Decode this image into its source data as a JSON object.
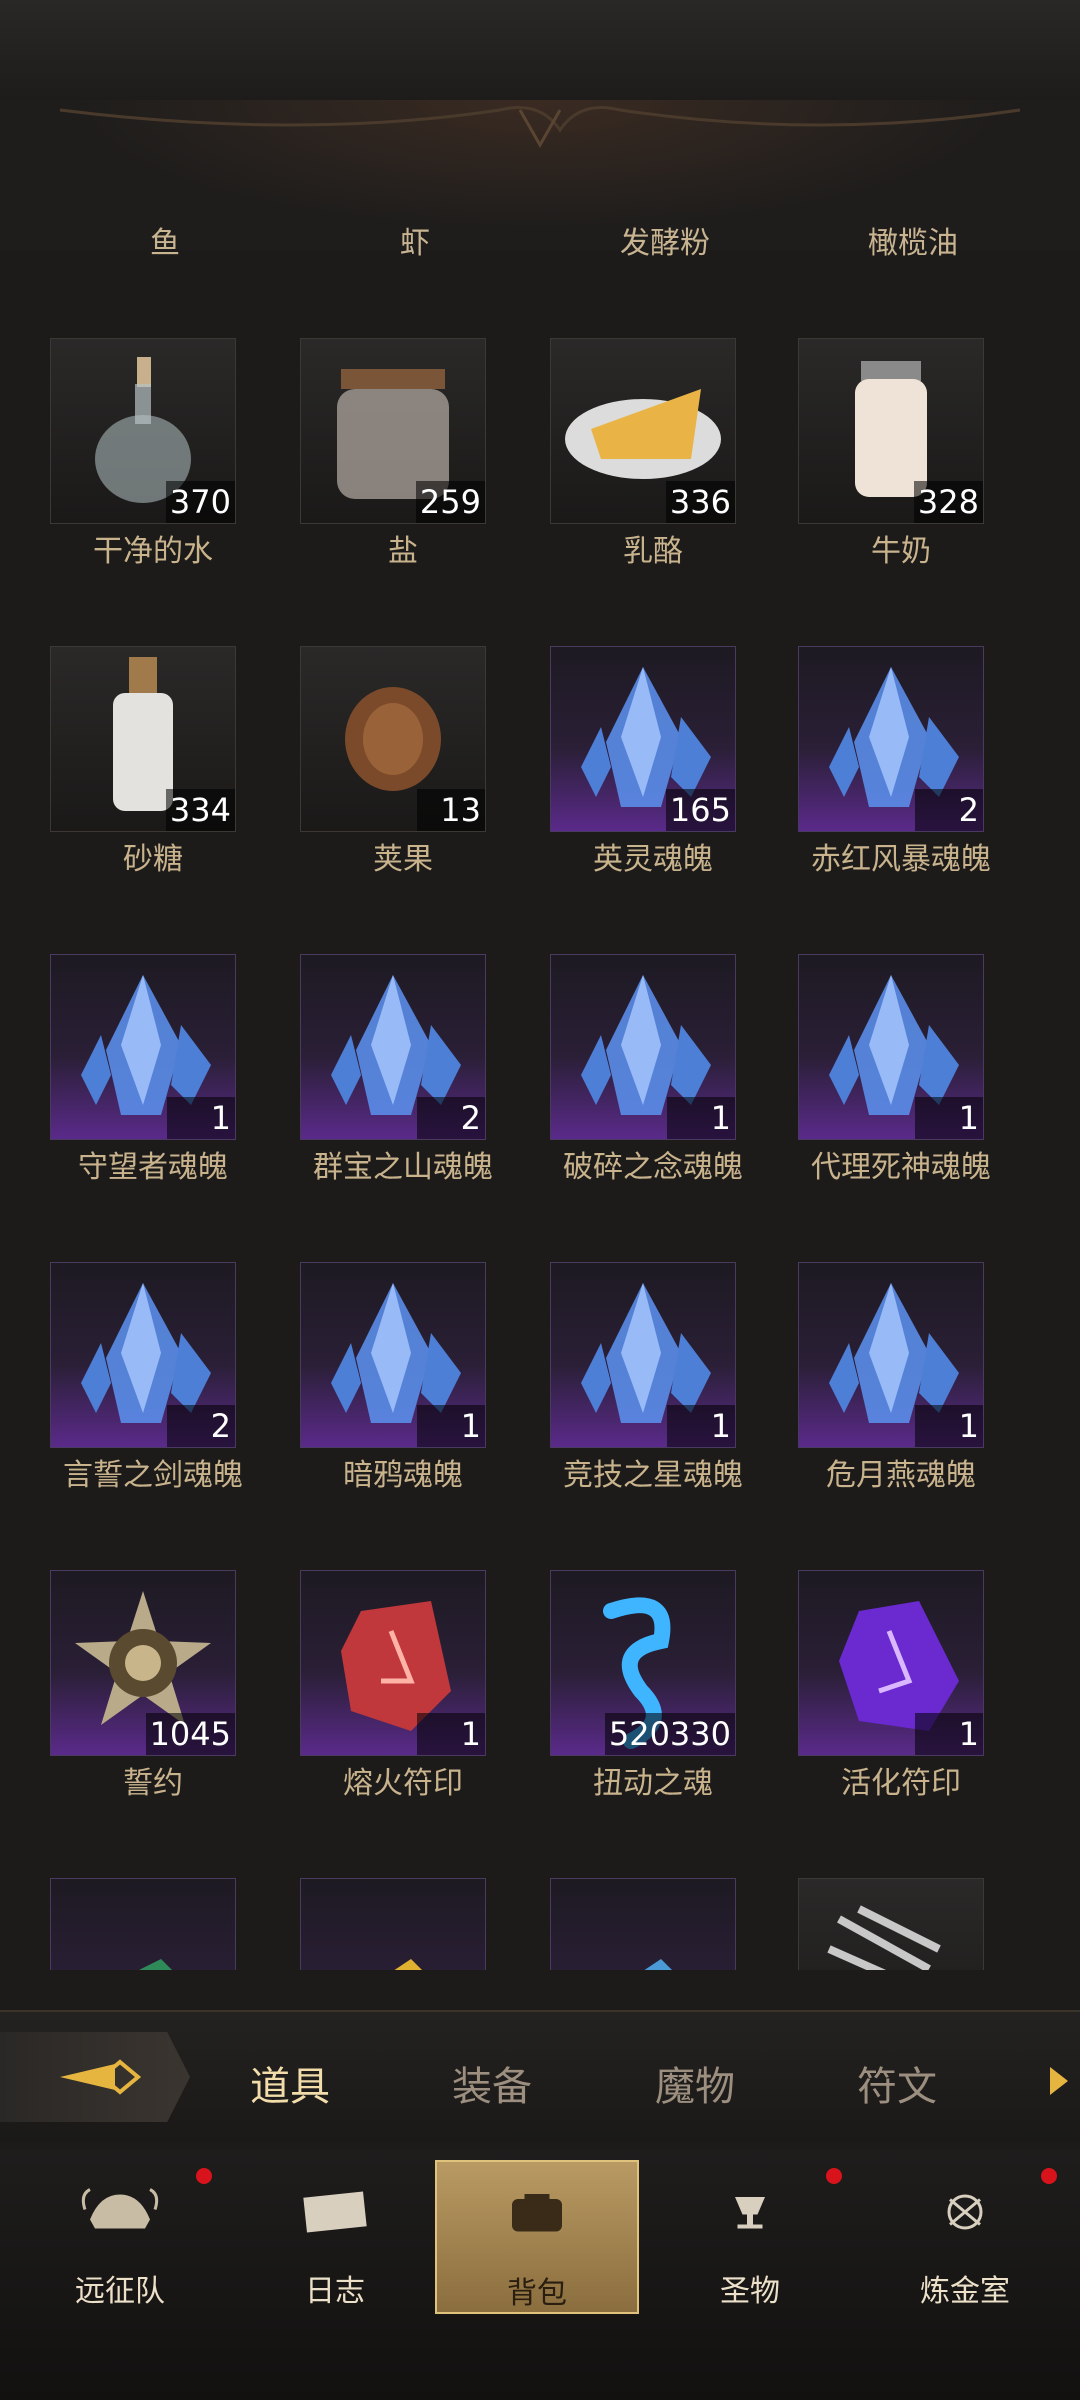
{
  "header_labels": [
    "鱼",
    "虾",
    "发酵粉",
    "橄榄油"
  ],
  "items": [
    {
      "name": "干净的水",
      "count": "370",
      "rarity": "normal",
      "icon": "water-flask-icon"
    },
    {
      "name": "盐",
      "count": "259",
      "rarity": "normal",
      "icon": "salt-jar-icon"
    },
    {
      "name": "乳酪",
      "count": "336",
      "rarity": "normal",
      "icon": "cheese-plate-icon"
    },
    {
      "name": "牛奶",
      "count": "328",
      "rarity": "normal",
      "icon": "milk-jar-icon"
    },
    {
      "name": "砂糖",
      "count": "334",
      "rarity": "normal",
      "icon": "sugar-bottle-icon"
    },
    {
      "name": "荚果",
      "count": "13",
      "rarity": "normal",
      "icon": "pine-cone-icon"
    },
    {
      "name": "英灵魂魄",
      "count": "165",
      "rarity": "epic",
      "icon": "soul-crystal-icon"
    },
    {
      "name": "赤红风暴魂魄",
      "count": "2",
      "rarity": "epic",
      "icon": "soul-crystal-icon"
    },
    {
      "name": "守望者魂魄",
      "count": "1",
      "rarity": "epic",
      "icon": "soul-crystal-icon"
    },
    {
      "name": "群宝之山魂魄",
      "count": "2",
      "rarity": "epic",
      "icon": "soul-crystal-icon"
    },
    {
      "name": "破碎之念魂魄",
      "count": "1",
      "rarity": "epic",
      "icon": "soul-crystal-icon"
    },
    {
      "name": "代理死神魂魄",
      "count": "1",
      "rarity": "epic",
      "icon": "soul-crystal-icon"
    },
    {
      "name": "言誓之剑魂魄",
      "count": "2",
      "rarity": "epic",
      "icon": "soul-crystal-icon"
    },
    {
      "name": "暗鸦魂魄",
      "count": "1",
      "rarity": "epic",
      "icon": "soul-crystal-icon"
    },
    {
      "name": "竞技之星魂魄",
      "count": "1",
      "rarity": "epic",
      "icon": "soul-crystal-icon"
    },
    {
      "name": "危月燕魂魄",
      "count": "1",
      "rarity": "epic",
      "icon": "soul-crystal-icon"
    },
    {
      "name": "誓约",
      "count": "1045",
      "rarity": "epic",
      "icon": "oath-emblem-icon"
    },
    {
      "name": "熔火符印",
      "count": "1",
      "rarity": "epic",
      "icon": "red-rune-icon"
    },
    {
      "name": "扭动之魂",
      "count": "520330",
      "rarity": "epic",
      "icon": "blue-wisp-icon"
    },
    {
      "name": "活化符印",
      "count": "1",
      "rarity": "epic",
      "icon": "purple-rune-icon"
    },
    {
      "name": "",
      "count": "",
      "rarity": "epic",
      "icon": "green-rune-icon"
    },
    {
      "name": "",
      "count": "",
      "rarity": "epic",
      "icon": "yellow-rune-icon"
    },
    {
      "name": "",
      "count": "",
      "rarity": "epic",
      "icon": "blue-rune-icon"
    },
    {
      "name": "",
      "count": "",
      "rarity": "normal",
      "icon": "claw-bones-icon"
    }
  ],
  "tabs": {
    "labels": [
      "道具",
      "装备",
      "魔物",
      "符文"
    ],
    "active": "道具"
  },
  "nav": [
    {
      "label": "远征队",
      "icon": "helmet-icon",
      "badge": true
    },
    {
      "label": "日志",
      "icon": "scroll-icon",
      "badge": false
    },
    {
      "label": "背包",
      "icon": "backpack-icon",
      "badge": false,
      "active": true
    },
    {
      "label": "圣物",
      "icon": "chalice-icon",
      "badge": true
    },
    {
      "label": "炼金室",
      "icon": "alchemy-icon",
      "badge": true
    }
  ],
  "colors": {
    "accent": "#e6b540",
    "epic": "#5a2a8a",
    "badge": "#d8131b"
  }
}
